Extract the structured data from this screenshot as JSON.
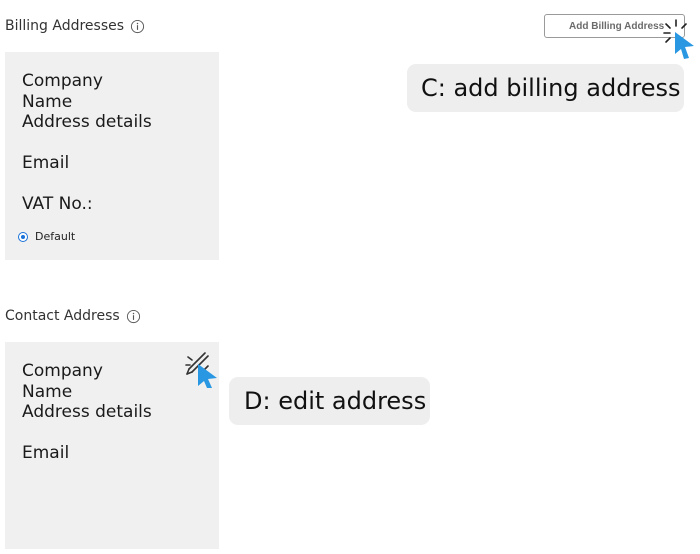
{
  "billing": {
    "title": "Billing Addresses",
    "add_button_label": "Add Billing Address",
    "card": {
      "company": "Company",
      "name": "Name",
      "address": "Address details",
      "email": "Email",
      "vat": "VAT No.:",
      "default_label": "Default"
    }
  },
  "contact": {
    "title": "Contact Address",
    "card": {
      "company": "Company",
      "name": "Name",
      "address": "Address details",
      "email": "Email"
    }
  },
  "annotations": {
    "c_label": "C: add billing address",
    "d_label": "D: edit address"
  },
  "icons": {
    "info": "info-circle-icon",
    "edit": "pencil-icon",
    "cursor": "pointer-cursor-icon",
    "click": "click-burst-icon"
  },
  "colors": {
    "accent": "#1a73d9",
    "cursor": "#2a97e2",
    "card_bg": "#f0f0f0",
    "callout_bg": "#eeeeee"
  }
}
